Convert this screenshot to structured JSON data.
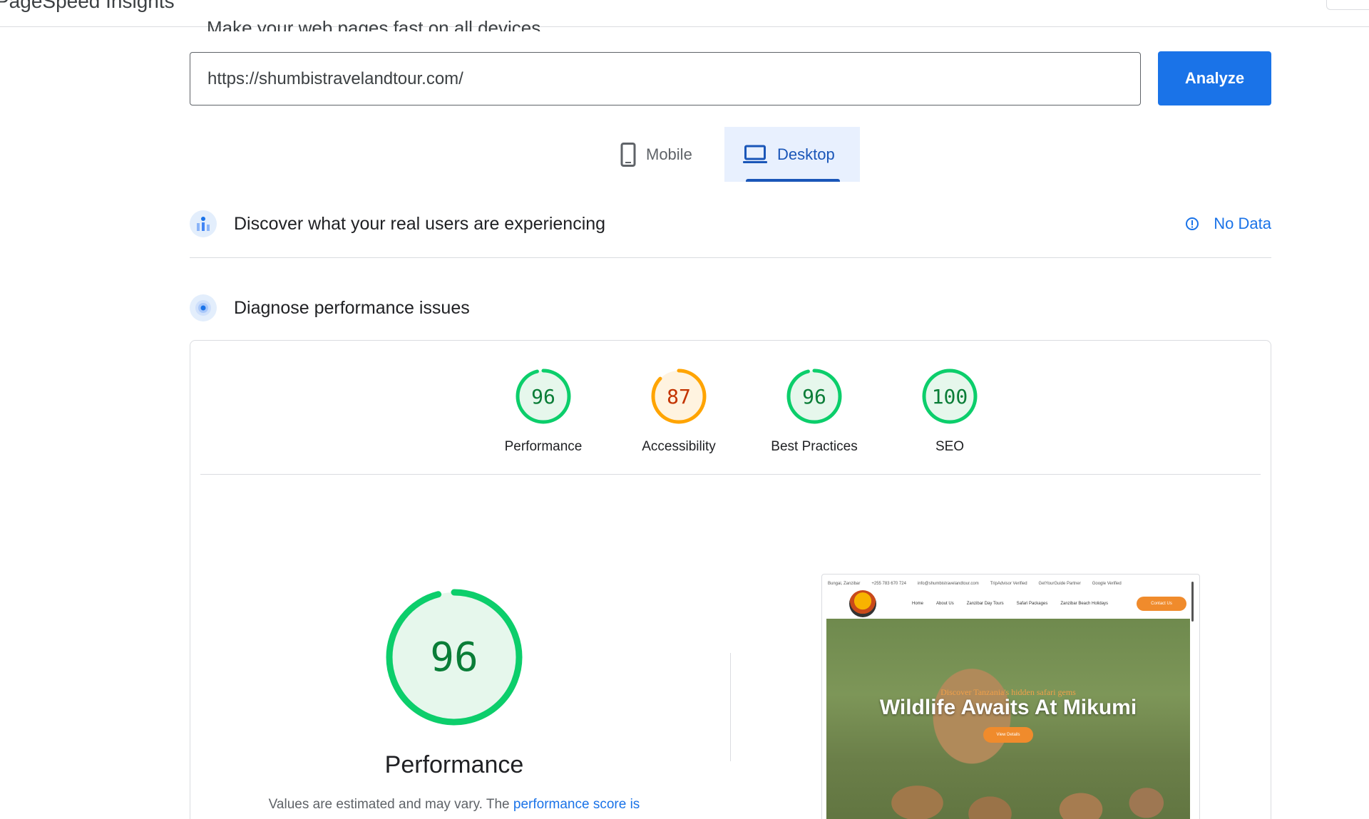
{
  "header": {
    "title": "PageSpeed Insights",
    "subtitle": "Make your web pages fast on all devices"
  },
  "url_input": {
    "value": "https://shumbistravelandtour.com/"
  },
  "analyze_button": {
    "label": "Analyze"
  },
  "tabs": [
    {
      "label": "Mobile",
      "icon": "phone-icon",
      "selected": false
    },
    {
      "label": "Desktop",
      "icon": "laptop-icon",
      "selected": true
    }
  ],
  "field_data": {
    "title": "Discover what your real users are experiencing",
    "status": "No Data"
  },
  "diagnose": {
    "title": "Diagnose performance issues"
  },
  "scores": [
    {
      "label": "Performance",
      "value": "96",
      "color": "#0cce6b",
      "text_color": "#0a7d37",
      "fill": "#e6f7ec"
    },
    {
      "label": "Accessibility",
      "value": "87",
      "color": "#ffa400",
      "text_color": "#c33300",
      "fill": "#fff3e0"
    },
    {
      "label": "Best Practices",
      "value": "96",
      "color": "#0cce6b",
      "text_color": "#0a7d37",
      "fill": "#e6f7ec"
    },
    {
      "label": "SEO",
      "value": "100",
      "color": "#0cce6b",
      "text_color": "#0a7d37",
      "fill": "#e6f7ec"
    }
  ],
  "performance": {
    "score": "96",
    "label": "Performance",
    "disclaimer_prefix": "Values are estimated and may vary. The ",
    "disclaimer_link": "performance score is"
  },
  "screenshot": {
    "topbar": [
      "Bungai, Zanzibar",
      "+255 783 670 724",
      "info@shumbistravelandtour.com",
      "TripAdvisor Verified",
      "GetYourGuide Partner",
      "Google Verified"
    ],
    "nav_links": [
      "Home",
      "About Us",
      "Zanzibar Day Tours",
      "Safari Packages",
      "Zanzibar Beach Holidays"
    ],
    "cta": "Contact Us",
    "eyebrow": "Discover Tanzania's hidden safari gems",
    "headline": "Wildlife Awaits At Mikumi",
    "button": "View Details"
  },
  "colors": {
    "accent": "#1a73e8",
    "pass": "#0cce6b",
    "average": "#ffa400"
  }
}
